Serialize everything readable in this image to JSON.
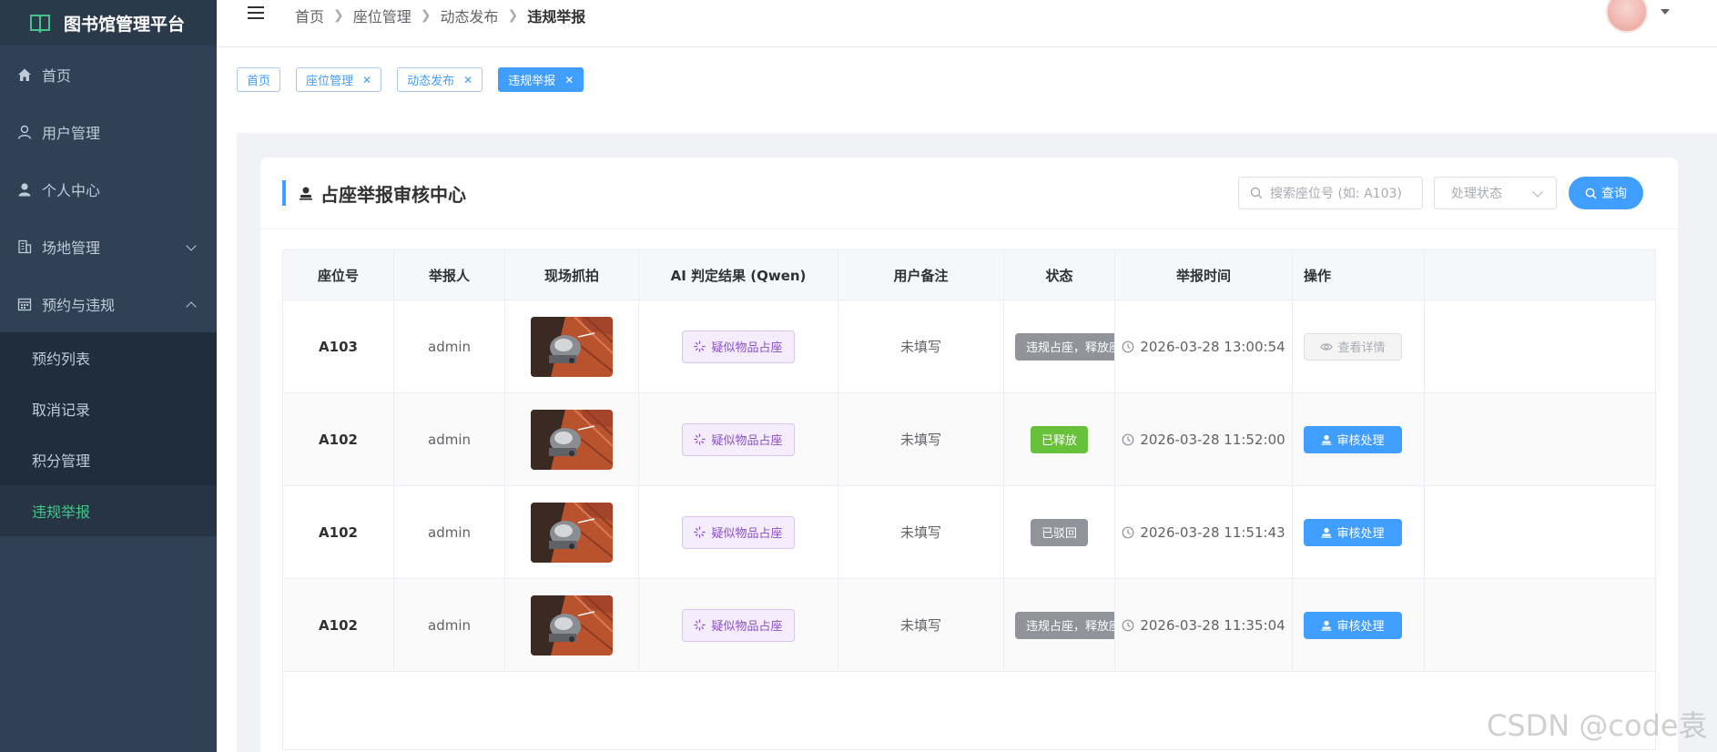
{
  "app": {
    "title": "图书馆管理平台"
  },
  "sidebar": {
    "items": [
      {
        "label": "首页",
        "icon": "home-icon"
      },
      {
        "label": "用户管理",
        "icon": "user-icon"
      },
      {
        "label": "个人中心",
        "icon": "person-icon"
      },
      {
        "label": "场地管理",
        "icon": "building-icon"
      },
      {
        "label": "预约与违规",
        "icon": "calendar-icon"
      }
    ],
    "subitems": [
      {
        "label": "预约列表"
      },
      {
        "label": "取消记录"
      },
      {
        "label": "积分管理"
      },
      {
        "label": "违规举报"
      }
    ],
    "active_color": "#44c488"
  },
  "breadcrumb": [
    "首页",
    "座位管理",
    "动态发布",
    "违规举报"
  ],
  "tags": [
    {
      "label": "首页"
    },
    {
      "label": "座位管理"
    },
    {
      "label": "动态发布"
    },
    {
      "label": "违规举报"
    }
  ],
  "card": {
    "title": "占座举报审核中心",
    "search_placeholder": "搜索座位号 (如: A103)",
    "status_placeholder": "处理状态",
    "query_label": "查询"
  },
  "table": {
    "headers": [
      "座位号",
      "举报人",
      "现场抓拍",
      "AI 判定结果 (Qwen)",
      "用户备注",
      "状态",
      "举报时间",
      "操作"
    ],
    "rows": [
      {
        "seat": "A103",
        "reporter": "admin",
        "ai": "疑似物品占座",
        "note": "未填写",
        "status": "违规占座，释放座位",
        "status_type": "gray-overflow",
        "time": "2026-03-28 13:00:54",
        "action": "查看详情",
        "action_type": "detail"
      },
      {
        "seat": "A102",
        "reporter": "admin",
        "ai": "疑似物品占座",
        "note": "未填写",
        "status": "已释放",
        "status_type": "green",
        "time": "2026-03-28 11:52:00",
        "action": "审核处理",
        "action_type": "audit"
      },
      {
        "seat": "A102",
        "reporter": "admin",
        "ai": "疑似物品占座",
        "note": "未填写",
        "status": "已驳回",
        "status_type": "gray",
        "time": "2026-03-28 11:51:43",
        "action": "审核处理",
        "action_type": "audit"
      },
      {
        "seat": "A102",
        "reporter": "admin",
        "ai": "疑似物品占座",
        "note": "未填写",
        "status": "违规占座，释放座位",
        "status_type": "gray-overflow",
        "time": "2026-03-28 11:35:04",
        "action": "审核处理",
        "action_type": "audit"
      }
    ]
  },
  "watermark": "CSDN @code袁"
}
